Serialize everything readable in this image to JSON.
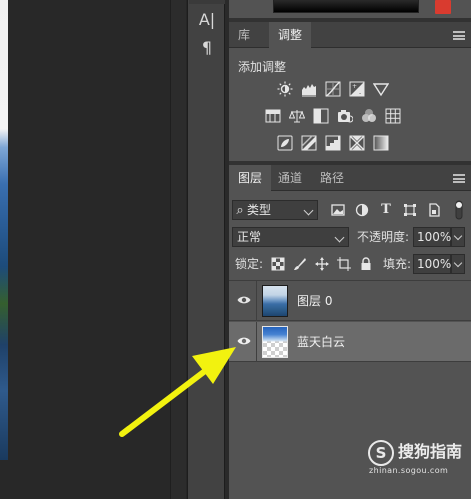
{
  "tool_strip": {
    "text_tool_glyph": "A|",
    "paragraph_tool_glyph": "¶"
  },
  "adjustments_panel": {
    "tabs": [
      {
        "label": "库",
        "active": false
      },
      {
        "label": "调整",
        "active": true
      }
    ],
    "title": "添加调整",
    "row1_icons": [
      "brightness-contrast-icon",
      "levels-icon",
      "curves-icon",
      "exposure-icon",
      "vibrance-icon"
    ],
    "row2_icons": [
      "hue-saturation-icon",
      "color-balance-icon",
      "black-white-icon",
      "photo-filter-icon",
      "channel-mixer-icon",
      "color-lookup-icon"
    ],
    "row3_icons": [
      "invert-icon",
      "posterize-icon",
      "threshold-icon",
      "selective-color-icon",
      "gradient-map-icon"
    ]
  },
  "layers_panel": {
    "tabs": [
      {
        "label": "图层",
        "active": true
      },
      {
        "label": "通道",
        "active": false
      },
      {
        "label": "路径",
        "active": false
      }
    ],
    "filter": {
      "search_glyph": "⌕",
      "value": "类型",
      "filter_icons": [
        "pixel-filter-icon",
        "adjustment-filter-icon",
        "type-filter-icon",
        "shape-filter-icon",
        "smart-object-filter-icon",
        "filter-toggle-icon"
      ]
    },
    "blend_mode": "正常",
    "opacity_label": "不透明度:",
    "opacity_value": "100%",
    "lock_label": "锁定:",
    "lock_icons": [
      "lock-transparent-icon",
      "lock-image-icon",
      "lock-position-icon",
      "lock-artboard-icon",
      "lock-all-icon"
    ],
    "fill_label": "填充:",
    "fill_value": "100%",
    "layers": [
      {
        "name": "图层 0",
        "visible": true,
        "selected": false
      },
      {
        "name": "蓝天白云",
        "visible": true,
        "selected": true
      }
    ]
  },
  "watermark": {
    "logo_glyph": "S",
    "text": "搜狗指南",
    "url": "zhinan.sogou.com"
  },
  "colors": {
    "panel_bg": "#535353",
    "tabbar_bg": "#424242",
    "selected_row": "#6b6b6b",
    "arrow": "#f2f20f"
  }
}
